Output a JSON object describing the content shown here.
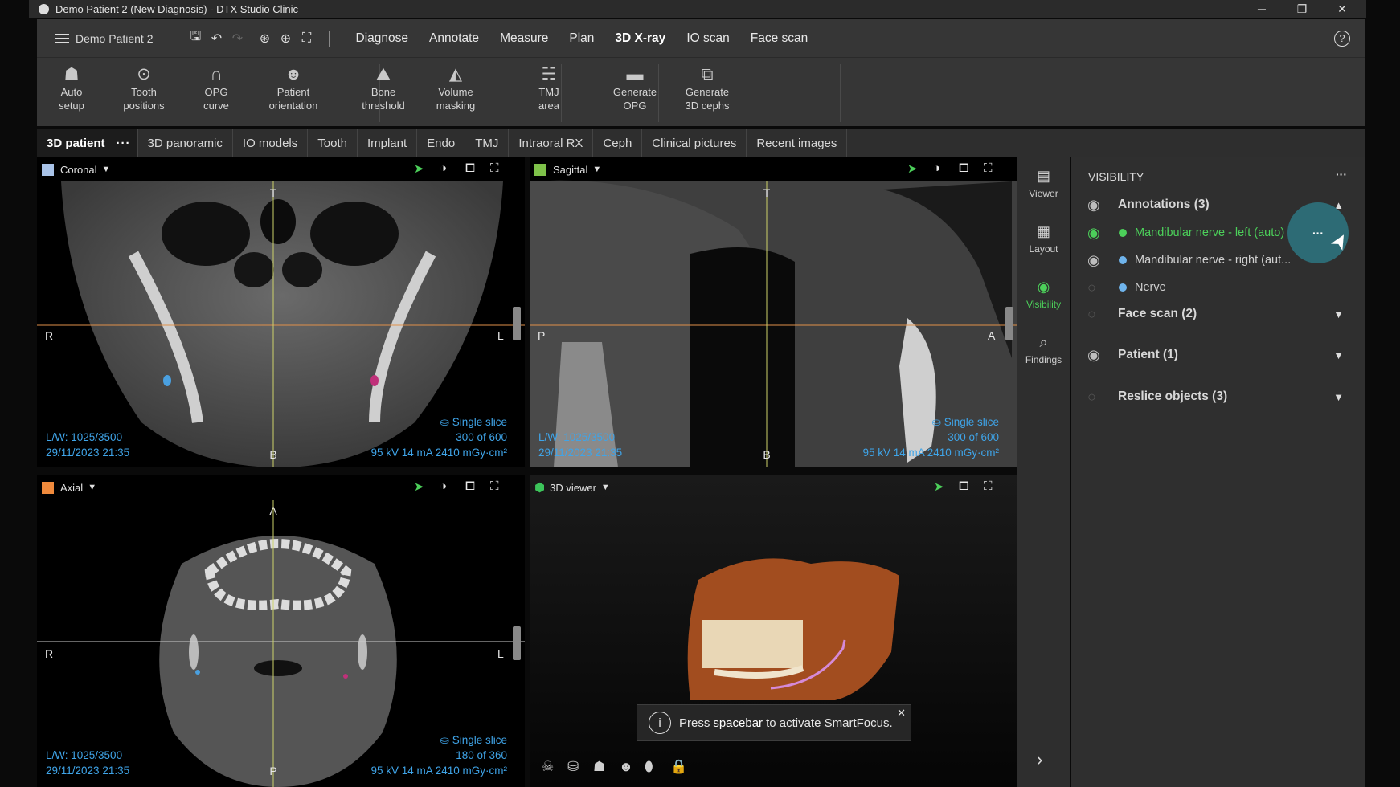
{
  "window": {
    "title": "Demo Patient 2 (New Diagnosis) - DTX Studio Clinic",
    "minimize": "─",
    "restore": "❐",
    "close": "✕"
  },
  "menubar": {
    "patient": "Demo Patient 2",
    "tabs": [
      "Diagnose",
      "Annotate",
      "Measure",
      "Plan",
      "3D X-ray",
      "IO scan",
      "Face scan"
    ],
    "active_tab": "3D X-ray",
    "help": "?"
  },
  "ribbon": [
    {
      "label1": "Auto",
      "label2": "setup",
      "icon": "auto-setup-icon",
      "glyph": "☗"
    },
    {
      "label1": "Tooth",
      "label2": "positions",
      "icon": "tooth-positions-icon",
      "glyph": "⊙"
    },
    {
      "label1": "OPG",
      "label2": "curve",
      "icon": "opg-curve-icon",
      "glyph": "∩"
    },
    {
      "label1": "Patient",
      "label2": "orientation",
      "icon": "patient-orientation-icon",
      "glyph": "☻"
    },
    {
      "label1": "Bone",
      "label2": "threshold",
      "icon": "bone-threshold-icon",
      "glyph": "⛰"
    },
    {
      "label1": "Volume",
      "label2": "masking",
      "icon": "volume-masking-icon",
      "glyph": "◭"
    },
    {
      "label1": "TMJ",
      "label2": "area",
      "icon": "tmj-area-icon",
      "glyph": "☵"
    },
    {
      "label1": "Generate",
      "label2": "OPG",
      "icon": "generate-opg-icon",
      "glyph": "▬"
    },
    {
      "label1": "Generate",
      "label2": "3D cephs",
      "icon": "generate-3d-cephs-icon",
      "glyph": "⧉"
    }
  ],
  "image_tabs": [
    "3D patient",
    "3D panoramic",
    "IO models",
    "Tooth",
    "Implant",
    "Endo",
    "TMJ",
    "Intraoral RX",
    "Ceph",
    "Clinical pictures",
    "Recent images"
  ],
  "image_tabs_more": "···",
  "views": {
    "coronal": {
      "name": "Coronal",
      "color": "#a9c3e8",
      "lw": "L/W: 1025/3500",
      "date": "29/11/2023 21:35",
      "mode": "Single slice",
      "slice": "300 of 600",
      "exposure": "95 kV  14 mA  2410 mGy·cm²",
      "top": "T",
      "bottom": "B",
      "left": "R",
      "right": "L"
    },
    "sagittal": {
      "name": "Sagittal",
      "color": "#7fc24a",
      "lw": "L/W: 1025/3500",
      "date": "29/11/2023 21:35",
      "mode": "Single slice",
      "slice": "300 of 600",
      "exposure": "95 kV  14 mA  2410 mGy·cm²",
      "top": "T",
      "bottom": "B",
      "left": "P",
      "right": "A"
    },
    "axial": {
      "name": "Axial",
      "color": "#f08a3c",
      "lw": "L/W: 1025/3500",
      "date": "29/11/2023 21:35",
      "mode": "Single slice",
      "slice": "180 of 360",
      "exposure": "95 kV  14 mA  2410 mGy·cm²",
      "top": "A",
      "bottom": "P",
      "left": "R",
      "right": "L"
    },
    "viewer3d": {
      "name": "3D viewer",
      "color": "#3cc45a"
    }
  },
  "toast": {
    "prefix": "Press ",
    "key": "spacebar",
    "suffix": " to activate SmartFocus."
  },
  "sidebar": [
    {
      "label": "Viewer",
      "icon": "viewer-icon",
      "glyph": "▤"
    },
    {
      "label": "Layout",
      "icon": "layout-icon",
      "glyph": "▦"
    },
    {
      "label": "Visibility",
      "icon": "visibility-icon",
      "glyph": "◉"
    },
    {
      "label": "Findings",
      "icon": "findings-icon",
      "glyph": "⌕"
    }
  ],
  "sidebar_expand": "›",
  "visibility": {
    "title": "VISIBILITY",
    "more": "···",
    "groups": [
      {
        "label": "Annotations (3)",
        "visible": true,
        "expanded": true
      },
      {
        "label": "Face scan (2)",
        "visible": false,
        "expanded": false
      },
      {
        "label": "Patient (1)",
        "visible": true,
        "expanded": false
      },
      {
        "label": "Reslice objects (3)",
        "visible": false,
        "expanded": false
      }
    ],
    "annotations": [
      {
        "label": "Mandibular nerve - left (auto)",
        "color": "#4cd05a",
        "visible": true,
        "highlighted": true
      },
      {
        "label": "Mandibular nerve - right (aut...",
        "color": "#6fb4ec",
        "visible": true,
        "highlighted": false
      },
      {
        "label": "Nerve",
        "color": "#6fb4ec",
        "visible": false,
        "highlighted": false
      }
    ],
    "item_more": "···"
  },
  "accent": {
    "green": "#4cd05a",
    "blue": "#3fa4e8",
    "highlight": "#2d6b75"
  }
}
